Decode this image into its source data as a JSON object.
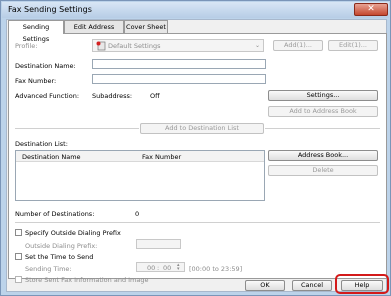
{
  "window": {
    "title": "Fax Sending Settings",
    "close_glyph": "✕"
  },
  "tabs": [
    {
      "label": "Sending Settings"
    },
    {
      "label": "Edit Address Book"
    },
    {
      "label": "Cover Sheet"
    }
  ],
  "profile": {
    "label": "Profile:",
    "value": "Default Settings",
    "add_label": "Add(1)...",
    "edit_label": "Edit(1)..."
  },
  "destination": {
    "name_label": "Destination Name:",
    "name_value": "",
    "fax_label": "Fax Number:",
    "fax_value": "",
    "advanced_label": "Advanced Function:",
    "subaddress_label": "Subaddress:",
    "subaddress_value": "Off",
    "settings_label": "Settings...",
    "add_to_address_book_label": "Add to Address Book",
    "add_to_list_label": "Add to Destination List"
  },
  "destination_list": {
    "label": "Destination List:",
    "columns": [
      "Destination Name",
      "Fax Number"
    ],
    "rows": [],
    "address_book_label": "Address Book...",
    "delete_label": "Delete",
    "count_label": "Number of Destinations:",
    "count_value": "0"
  },
  "options": {
    "outside_prefix_label": "Specify Outside Dialing Prefix",
    "outside_prefix_field_label": "Outside Dialing Prefix:",
    "send_time_label": "Set the Time to Send",
    "sending_time_label": "Sending Time:",
    "time_hour": "00",
    "time_sep": ":",
    "time_minute": "00",
    "time_range": "[00:00 to 23:59]",
    "store_label": "Store Sent Fax Information and Image"
  },
  "footer": {
    "ok_label": "OK",
    "cancel_label": "Cancel",
    "help_label": "Help"
  },
  "colors": {
    "highlight": "#d31a1a",
    "window_frame": "#bcd3ea"
  }
}
